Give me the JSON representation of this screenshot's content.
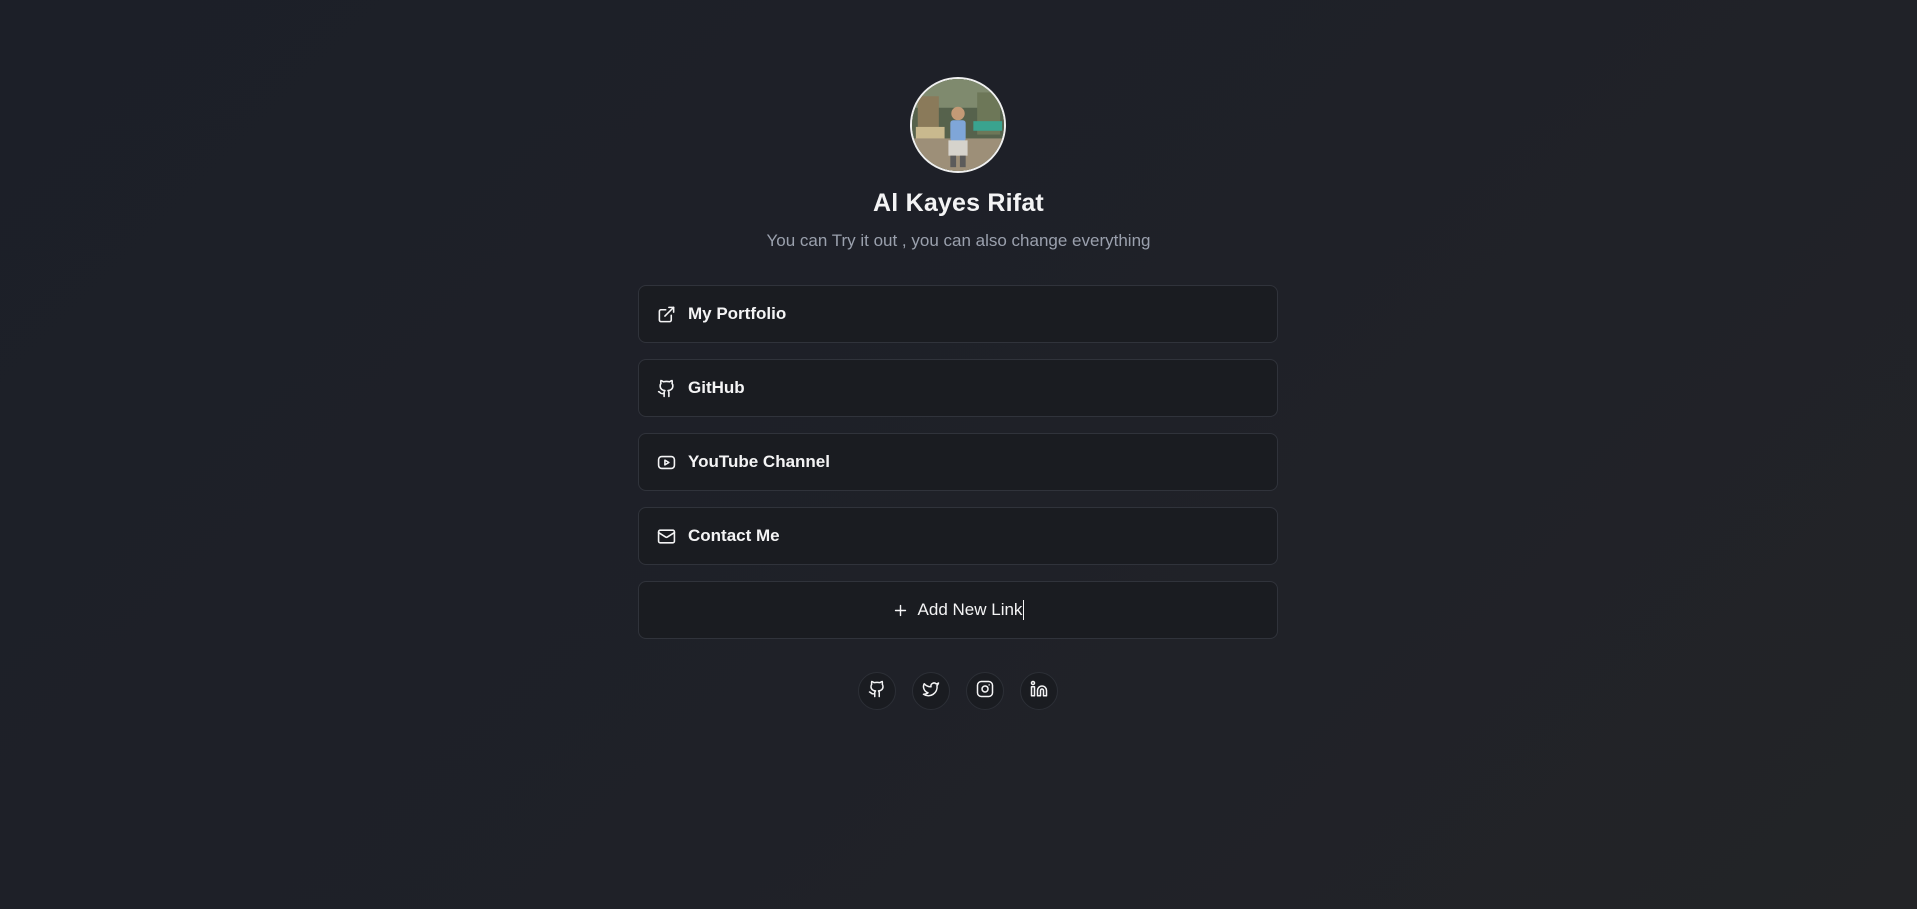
{
  "profile": {
    "name": "Al Kayes Rifat",
    "bio": "You can Try it out , you can also change everything"
  },
  "links": [
    {
      "label": "My Portfolio",
      "icon": "external-link-icon"
    },
    {
      "label": "GitHub",
      "icon": "github-icon"
    },
    {
      "label": "YouTube Channel",
      "icon": "youtube-icon"
    },
    {
      "label": "Contact Me",
      "icon": "mail-icon"
    }
  ],
  "add_link": {
    "label": "Add New Link",
    "icon": "plus-icon"
  },
  "socials": [
    {
      "icon": "github-icon"
    },
    {
      "icon": "twitter-icon"
    },
    {
      "icon": "instagram-icon"
    },
    {
      "icon": "linkedin-icon"
    }
  ],
  "colors": {
    "background": "#1e2028",
    "card": "#1a1c21",
    "card_border": "#30333b",
    "text": "#f4f4f5",
    "muted_text": "#9aa0ad"
  }
}
